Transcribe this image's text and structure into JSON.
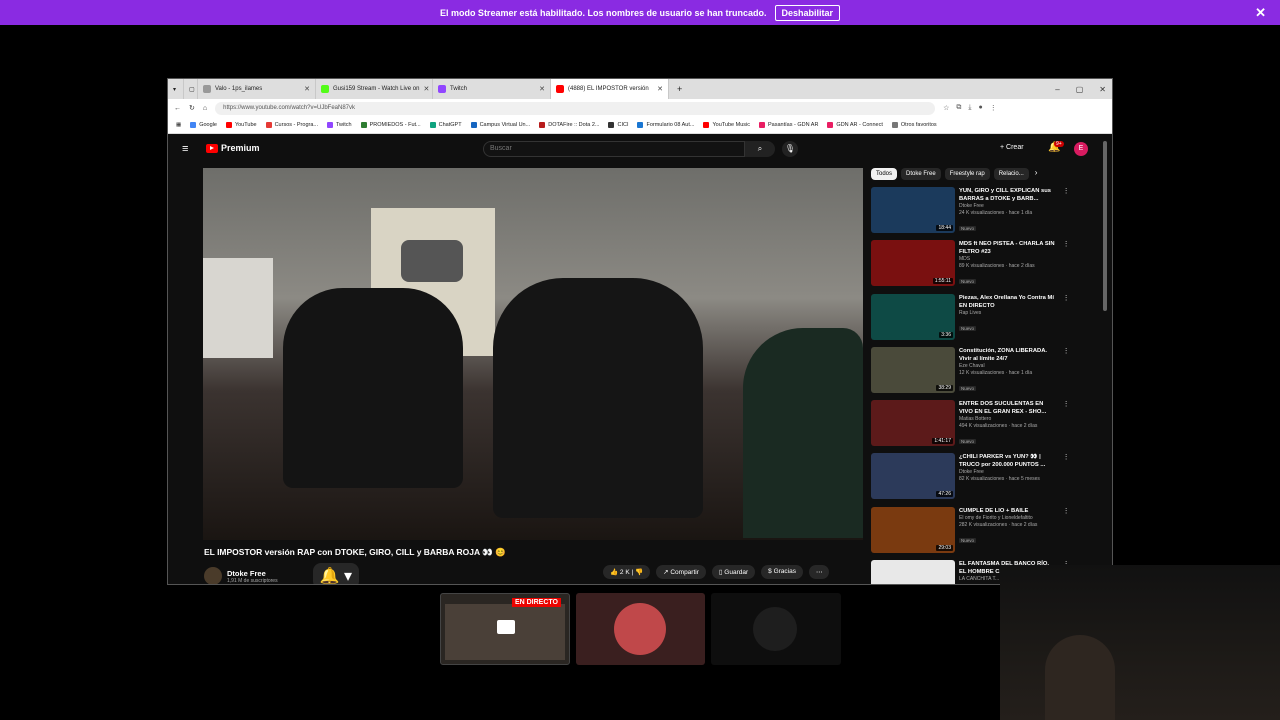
{
  "banner": {
    "text": "El modo Streamer está habilitado. Los nombres de usuario se han truncado.",
    "button": "Deshabilitar",
    "close": "✕",
    "color": "#8a2be2"
  },
  "tabs": [
    {
      "label": "Valo - 1ps_ilames",
      "color": "#999"
    },
    {
      "label": "Gusi159 Stream - Watch Live on",
      "color": "#53fc18"
    },
    {
      "label": "Twitch",
      "color": "#9146ff"
    },
    {
      "label": "(4888) EL IMPOSTOR versión",
      "color": "#ff0000"
    }
  ],
  "url": "https://www.youtube.com/watch?v=UJbFeaN87vk",
  "bookmarks": [
    {
      "label": "Google",
      "color": "#4285f4"
    },
    {
      "label": "YouTube",
      "color": "#ff0000"
    },
    {
      "label": "Cursos - Progra...",
      "color": "#e53935"
    },
    {
      "label": "Twitch",
      "color": "#9146ff"
    },
    {
      "label": "PROMIEDOS - Fut...",
      "color": "#2e7d32"
    },
    {
      "label": "ChatGPT",
      "color": "#10a37f"
    },
    {
      "label": "Campus Virtual Un...",
      "color": "#1565c0"
    },
    {
      "label": "DOTAFire :: Dota 2...",
      "color": "#b71c1c"
    },
    {
      "label": "CICI",
      "color": "#333"
    },
    {
      "label": "Formulario 08 Aut...",
      "color": "#1976d2"
    },
    {
      "label": "YouTube Music",
      "color": "#ff0000"
    },
    {
      "label": "Pasantías - GDN AR",
      "color": "#e91e63"
    },
    {
      "label": "GDN AR - Connect",
      "color": "#e91e63"
    },
    {
      "label": "Otros favoritos",
      "color": "#777"
    }
  ],
  "youtube": {
    "logo": "Premium",
    "search_placeholder": "Buscar",
    "create": "Crear",
    "notif_badge": "9+",
    "avatar_letter": "E",
    "video_title": "EL IMPOSTOR versión RAP con DTOKE, GIRO, CILL y BARBA ROJA 👀 😊",
    "channel": "Dtoke Free",
    "subs": "1,91 M de suscriptores",
    "likes": "2 K",
    "share": "Compartir",
    "save": "Guardar",
    "thanks": "Gracias",
    "chips": [
      "Todos",
      "Dtoke Free",
      "Freestyle rap",
      "Relacio..."
    ],
    "recs": [
      {
        "title": "YUN, GIRO y CILL EXPLICAN sus BARRAS a DTOKE y BARB...",
        "channel": "Dtoke Free",
        "views": "24 K visualizaciones · hace 1 día",
        "badge": "Nuevo",
        "dur": "18:44",
        "thumb": "#1b3a5c"
      },
      {
        "title": "MDS ft NEO PISTEA - CHARLA SIN FILTRO #23",
        "channel": "MDS",
        "views": "89 K visualizaciones · hace 2 días",
        "badge": "Nuevo",
        "dur": "1:55:11",
        "thumb": "#7a1010"
      },
      {
        "title": "Piezas, Alex Orellana  Yo Contra Mí EN DIRECTO",
        "channel": "Rap Lives",
        "views": "",
        "badge": "Nuevo",
        "dur": "3:36",
        "thumb": "#0e4a45"
      },
      {
        "title": "Constitución, ZONA LIBERADA. Vivir al límite 24/7",
        "channel": "Eze Chaval",
        "views": "12 K visualizaciones · hace 1 día",
        "badge": "Nuevo",
        "dur": "38:29",
        "thumb": "#4a4a3a"
      },
      {
        "title": "ENTRE DOS SUCULENTAS EN VIVO EN EL GRAN REX - SHO...",
        "channel": "Matias Bottero",
        "views": "494 K visualizaciones · hace 2 días",
        "badge": "Nuevo",
        "dur": "1:41:17",
        "thumb": "#5c1a1a"
      },
      {
        "title": "¿CHILI PARKER vs YUN? 👀 | TRUCO por 200.000 PUNTOS ...",
        "channel": "Dtoke Free",
        "views": "82 K visualizaciones · hace 5 meses",
        "badge": "",
        "dur": "47:26",
        "thumb": "#2c3a5a"
      },
      {
        "title": "CUMPLE DE LIO + BAILE",
        "channel": "El omy de Fiorito y Lioneldefaltito",
        "views": "282 K visualizaciones · hace 2 días",
        "badge": "Nuevo",
        "dur": "29:03",
        "thumb": "#7a3a10"
      },
      {
        "title": "EL FANTASMA DEL BANCO RÍO, EL HOMBRE C...",
        "channel": "LA CANCHITA T...",
        "views": "",
        "badge": "",
        "dur": "",
        "thumb": "#e8e8e8"
      }
    ]
  },
  "tiles": {
    "live_label": "EN DIRECTO"
  }
}
